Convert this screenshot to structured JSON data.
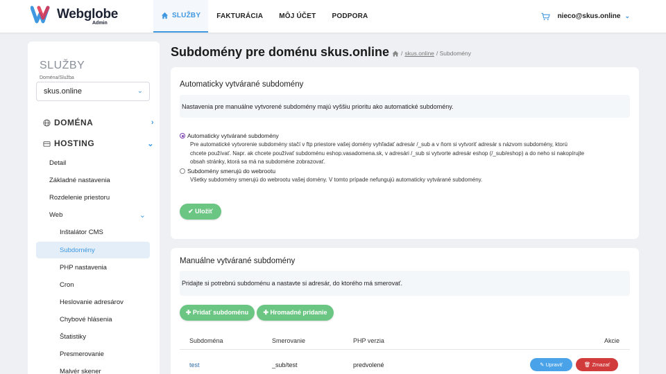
{
  "brand": {
    "name": "Webglobe",
    "sub": "Admin",
    "colors": {
      "accent": "#3f98e0",
      "green": "#6cc683",
      "red": "#d23b3b",
      "blue": "#4aa3e8"
    }
  },
  "nav": {
    "items": [
      "SLUŽBY",
      "FAKTURÁCIA",
      "MÔJ ÚČET",
      "PODPORA"
    ],
    "user": "nieco@skus.online"
  },
  "sidebar": {
    "title": "SLUŽBY",
    "select_label": "Doména/Služba",
    "select_value": "skus.online",
    "groups": [
      "DOMÉNA",
      "HOSTING"
    ],
    "items": [
      "Detail",
      "Základné nastavenia",
      "Rozdelenie priestoru",
      "Web"
    ],
    "sub_items": [
      "Inštalátor CMS",
      "Subdomény",
      "PHP nastavenia",
      "Cron",
      "Heslovanie adresárov",
      "Chybové hlásenia",
      "Štatistiky",
      "Presmerovanie",
      "Malvér skener"
    ]
  },
  "page": {
    "title": "Subdomény pre doménu skus.online",
    "breadcrumb": [
      "skus.online",
      "/ Subdomény"
    ]
  },
  "auto_card": {
    "title": "Automaticky vytvárané subdomény",
    "info": "Nastavenia pre manuálne vytvorené subdomény majú vyššiu prioritu ako automatické subdomény.",
    "option1_label": "Automaticky vytvárané subdomény",
    "option1_desc1": "Pre automatické vytvorenie subdomény stačí v ftp priestore vašej domény vyhľadať adresár /_sub a v ňom si vytvoriť adresár s názvom subdomény, ktorú",
    "option1_desc2": "chcete používať. Napr. ak chcete používať subdoménu eshop.vasadomena.sk, v adresári /_sub si vytvorte adresár eshop (/_sub/eshop) a do neho si nakopírujte",
    "option1_desc3": "obsah stránky, ktorá sa má na subdoméne zobrazovať.",
    "option2_label": "Subdomény smerujú do webrootu",
    "option2_desc": "Všetky subdomény smerujú do webrootu vašej domény. V tomto prípade nefungujú automaticky vytvárané subdomény.",
    "save_label": "✔ Uložiť"
  },
  "manual_card": {
    "title": "Manuálne vytvárané subdomény",
    "info": "Pridajte si potrebnú subdoménu a nastavte si adresár, do ktorého má smerovať.",
    "add_label": "✚ Pridať subdoménu",
    "bulk_label": "✚ Hromadné pridanie",
    "columns": [
      "Subdoména",
      "Smerovanie",
      "PHP verzia",
      "Akcie"
    ],
    "rows": [
      {
        "subdomain": "test",
        "target": "_sub/test",
        "php": "predvolené",
        "edit": "Upraviť",
        "delete": "Zmazať"
      }
    ]
  }
}
